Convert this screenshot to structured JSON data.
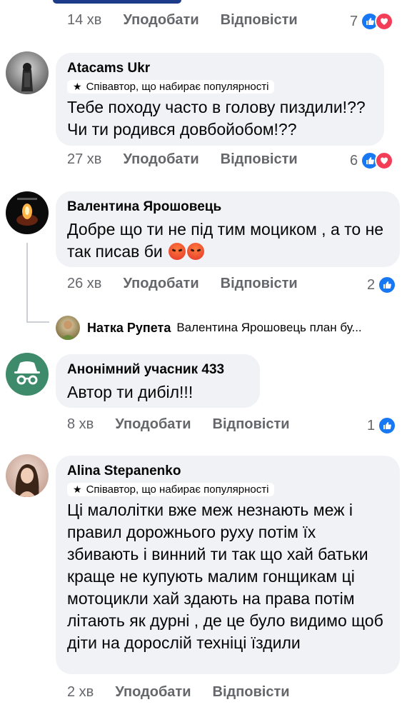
{
  "colors": {
    "like_blue": "#1877f2",
    "love_red": "#f33e58",
    "bubble_bg": "#f0f2f5",
    "meta_gray": "#65676b"
  },
  "top_meta": {
    "time": "14 хв",
    "like_label": "Уподобати",
    "reply_label": "Відповісти",
    "reaction_count": "7"
  },
  "comments": [
    {
      "author": "Atacams Ukr",
      "badge": "Співавтор, що набирає популярності",
      "text": "Тебе походу часто в голову пиздили!?? Чи ти родився довбойобом!??",
      "time": "27 хв",
      "like_label": "Уподобати",
      "reply_label": "Відповісти",
      "reaction_count": "6",
      "reactions": [
        "like-icon",
        "love-icon"
      ]
    },
    {
      "author": "Валентина Ярошовець",
      "text": "Добре що ти не під тим моциком , а то не так писав би",
      "time": "26 хв",
      "like_label": "Уподобати",
      "reply_label": "Відповісти",
      "reaction_count": "2",
      "reactions": [
        "like-icon"
      ]
    },
    {
      "author": "Анонімний учасник 433",
      "text": "Автор ти дибіл!!!",
      "time": "8 хв",
      "like_label": "Уподобати",
      "reply_label": "Відповісти",
      "reaction_count": "1",
      "reactions": [
        "like-icon"
      ]
    },
    {
      "author": "Alina Stepanenko",
      "badge": "Співавтор, що набирає популярності",
      "text": "Ці малолітки вже меж незнають меж і правил дорожнього руху потім їх збивають і винний ти так що хай батьки краще не купують малим гонщикам ці мотоцикли хай здають на права потім літають як дурні , де це було видимо щоб діти на дорослій техніці їздили",
      "time": "2 хв",
      "like_label": "Уподобати",
      "reply_label": "Відповісти"
    }
  ],
  "reply_preview": {
    "author": "Натка Рупета",
    "text": "Валентина Ярошовець план бу..."
  }
}
